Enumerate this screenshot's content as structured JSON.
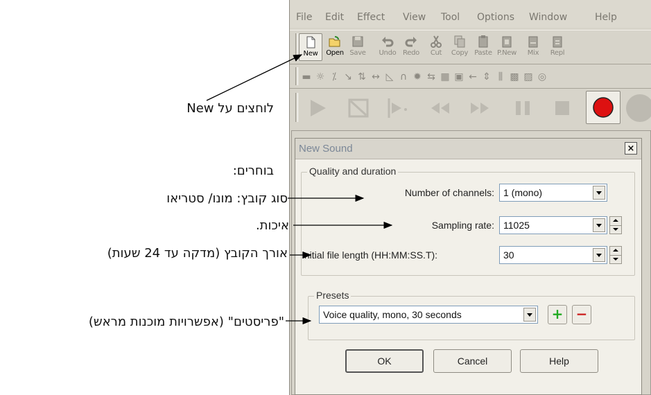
{
  "menubar": {
    "items": [
      "File",
      "Edit",
      "Effect",
      "View",
      "Tool",
      "Options",
      "Window",
      "Help"
    ]
  },
  "toolbar": {
    "buttons": [
      {
        "label": "New",
        "icon": "new-file-icon"
      },
      {
        "label": "Open",
        "icon": "open-folder-icon"
      },
      {
        "label": "Save",
        "icon": "save-disk-icon"
      },
      {
        "label": "Undo",
        "icon": "undo-icon"
      },
      {
        "label": "Redo",
        "icon": "redo-icon"
      },
      {
        "label": "Cut",
        "icon": "scissors-icon"
      },
      {
        "label": "Copy",
        "icon": "copy-icon"
      },
      {
        "label": "Paste",
        "icon": "paste-icon"
      },
      {
        "label": "P.New",
        "icon": "paste-new-icon"
      },
      {
        "label": "Mix",
        "icon": "mix-icon"
      },
      {
        "label": "Repl",
        "icon": "replace-icon"
      }
    ]
  },
  "dialog": {
    "title": "New Sound",
    "close_glyph": "×",
    "quality_group": "Quality and duration",
    "channels_label": "Number of channels:",
    "channels_value": "1 (mono)",
    "rate_label": "Sampling rate:",
    "rate_value": "11025",
    "length_label": "Initial file length (HH:MM:SS.T):",
    "length_value": "30",
    "presets_group": "Presets",
    "preset_value": "Voice quality, mono, 30 seconds",
    "add_glyph": "+",
    "remove_glyph": "−",
    "ok": "OK",
    "cancel": "Cancel",
    "help": "Help"
  },
  "annotations": {
    "new": "לוחצים על New",
    "choose": "בוחרים:",
    "type": "סוג קובץ: מונו/ סטריאו",
    "quality": "איכות.",
    "length": "אורך הקובץ (מדקה עד 24 שעות)",
    "presets": "\"פריסטים\" (אפשרויות מוכנות מראש)"
  },
  "colors": {
    "app_bg": "#d7d4ca",
    "dialog_bg": "#f2f0e9",
    "add_green": "#22aa22",
    "remove_red": "#cc2222",
    "record_red": "#dd1111"
  }
}
